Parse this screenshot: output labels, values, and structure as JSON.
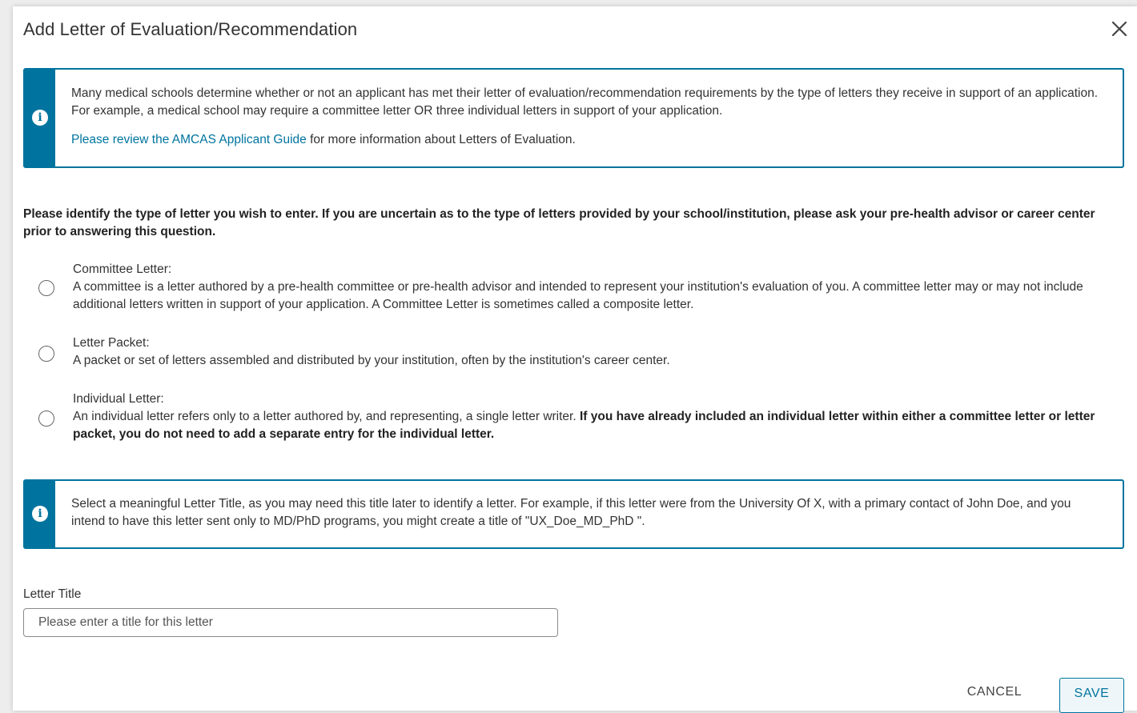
{
  "modal": {
    "title": "Add Letter of Evaluation/Recommendation",
    "close_icon": "close-icon"
  },
  "info_box_1": {
    "icon": "info-icon",
    "icon_glyph": "i",
    "text": "Many medical schools determine whether or not an applicant has met their letter of evaluation/recommendation requirements by the type of letters they receive in support of an application. For example, a medical school may require a committee letter OR three individual letters in support of your application.",
    "link_text": "Please review the AMCAS Applicant Guide",
    "link_suffix": " for more information about Letters of Evaluation."
  },
  "question": "Please identify the type of letter you wish to enter. If you are uncertain as to the type of letters provided by your school/institution, please ask your pre-health advisor or career center prior to answering this question.",
  "options": [
    {
      "title": "Committee Letter:",
      "description": "A committee is a letter authored by a pre-health committee or pre-health advisor and intended to represent your institution's evaluation of you. A committee letter may or may not include additional letters written in support of your application. A Committee Letter is sometimes called a composite letter.",
      "selected": false
    },
    {
      "title": "Letter Packet:",
      "description": "A packet or set of letters assembled and distributed by your institution, often by the institution's career center.",
      "selected": false
    },
    {
      "title": "Individual Letter:",
      "description": "An individual letter refers only to a letter authored by, and representing, a single letter writer. ",
      "description_bold": "If you have already included an individual letter within either a committee letter or letter packet, you do not need to add a separate entry for the individual letter.",
      "selected": false
    }
  ],
  "info_box_2": {
    "icon": "info-icon",
    "icon_glyph": "i",
    "text": "Select a meaningful Letter Title, as you may need this title later to identify a letter. For example, if this letter were from the University Of X, with a primary contact of John Doe, and you intend to have this letter sent only to MD/PhD programs, you might create a title of \"UX_Doe_MD_PhD \"."
  },
  "letter_title": {
    "label": "Letter Title",
    "placeholder": "Please enter a title for this letter",
    "value": ""
  },
  "actions": {
    "cancel_label": "CANCEL",
    "save_label": "SAVE"
  },
  "colors": {
    "accent": "#00749e",
    "text": "#333333",
    "background": "#ffffff"
  }
}
